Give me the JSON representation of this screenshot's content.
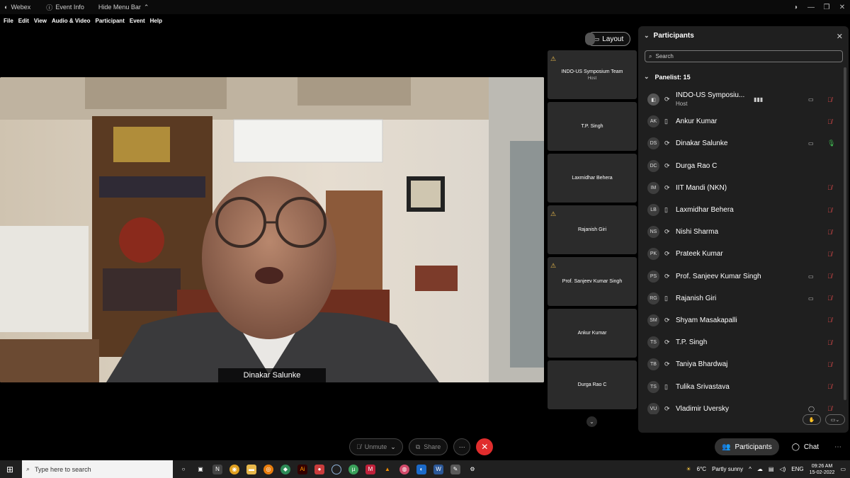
{
  "titlebar": {
    "app": "Webex",
    "event_info": "Event Info",
    "hide_menu": "Hide Menu Bar"
  },
  "menu": [
    "File",
    "Edit",
    "View",
    "Audio & Video",
    "Participant",
    "Event",
    "Help"
  ],
  "layout_label": "Layout",
  "main_video": {
    "speaker_name": "Dinakar Salunke"
  },
  "thumbnails": [
    {
      "name": "INDO-US Symposium Team",
      "sub": "Host",
      "warn": true
    },
    {
      "name": "T.P. Singh",
      "sub": "",
      "warn": false
    },
    {
      "name": "Laxmidhar Behera",
      "sub": "",
      "warn": false
    },
    {
      "name": "Rajanish Giri",
      "sub": "",
      "warn": true
    },
    {
      "name": "Prof. Sanjeev Kumar Singh",
      "sub": "",
      "warn": true
    },
    {
      "name": "Ankur Kumar",
      "sub": "",
      "warn": false
    },
    {
      "name": "Durga Rao C",
      "sub": "",
      "warn": false
    }
  ],
  "participants_panel": {
    "title": "Participants",
    "search_placeholder": "Search",
    "panelist_header": "Panelist: 15",
    "rows": [
      {
        "initials": "",
        "name": "INDO-US Symposiu...",
        "role": "Host",
        "device": "sync-icon",
        "video": true,
        "mute": "red",
        "audio_bars": true
      },
      {
        "initials": "AK",
        "name": "Ankur Kumar",
        "role": "",
        "device": "phone-icon",
        "video": false,
        "mute": "red"
      },
      {
        "initials": "DS",
        "name": "Dinakar Salunke",
        "role": "",
        "device": "sync-icon",
        "video": true,
        "mute": "green"
      },
      {
        "initials": "DC",
        "name": "Durga Rao C",
        "role": "",
        "device": "sync-icon",
        "video": false,
        "mute": ""
      },
      {
        "initials": "IM",
        "name": "IIT Mandi (NKN)",
        "role": "",
        "device": "sync-icon",
        "video": false,
        "mute": "red"
      },
      {
        "initials": "LB",
        "name": "Laxmidhar Behera",
        "role": "",
        "device": "phone-icon",
        "video": false,
        "mute": "red"
      },
      {
        "initials": "NS",
        "name": "Nishi Sharma",
        "role": "",
        "device": "sync-icon",
        "video": false,
        "mute": "red"
      },
      {
        "initials": "PK",
        "name": "Prateek Kumar",
        "role": "",
        "device": "sync-icon",
        "video": false,
        "mute": "red"
      },
      {
        "initials": "PS",
        "name": "Prof. Sanjeev Kumar Singh",
        "role": "",
        "device": "sync-icon",
        "video": true,
        "mute": "red"
      },
      {
        "initials": "RG",
        "name": "Rajanish Giri",
        "role": "",
        "device": "phone-icon",
        "video": true,
        "mute": "red"
      },
      {
        "initials": "SM",
        "name": "Shyam Masakapalli",
        "role": "",
        "device": "sync-icon",
        "video": false,
        "mute": "red"
      },
      {
        "initials": "TS",
        "name": "T.P. Singh",
        "role": "",
        "device": "sync-icon",
        "video": false,
        "mute": "red"
      },
      {
        "initials": "TB",
        "name": "Taniya Bhardwaj",
        "role": "",
        "device": "sync-icon",
        "video": false,
        "mute": "red"
      },
      {
        "initials": "TS",
        "name": "Tulika Srivastava",
        "role": "",
        "device": "phone-icon",
        "video": false,
        "mute": "red"
      },
      {
        "initials": "VU",
        "name": "Vladimir Uversky",
        "role": "",
        "device": "sync-icon",
        "video": false,
        "mute": "red",
        "chat": true
      }
    ]
  },
  "controls": {
    "unmute": "Unmute",
    "share": "Share",
    "participants": "Participants",
    "chat": "Chat"
  },
  "taskbar": {
    "search_placeholder": "Type here to search",
    "weather_temp": "6°C",
    "weather_desc": "Partly sunny",
    "lang": "ENG",
    "time": "09:26 AM",
    "date": "15-02-2022"
  },
  "colors": {
    "end_call": "#e02d2d",
    "mute_red": "#e04a4a",
    "unmute_green": "#3fb950",
    "panel_bg": "#1f1f1f"
  }
}
